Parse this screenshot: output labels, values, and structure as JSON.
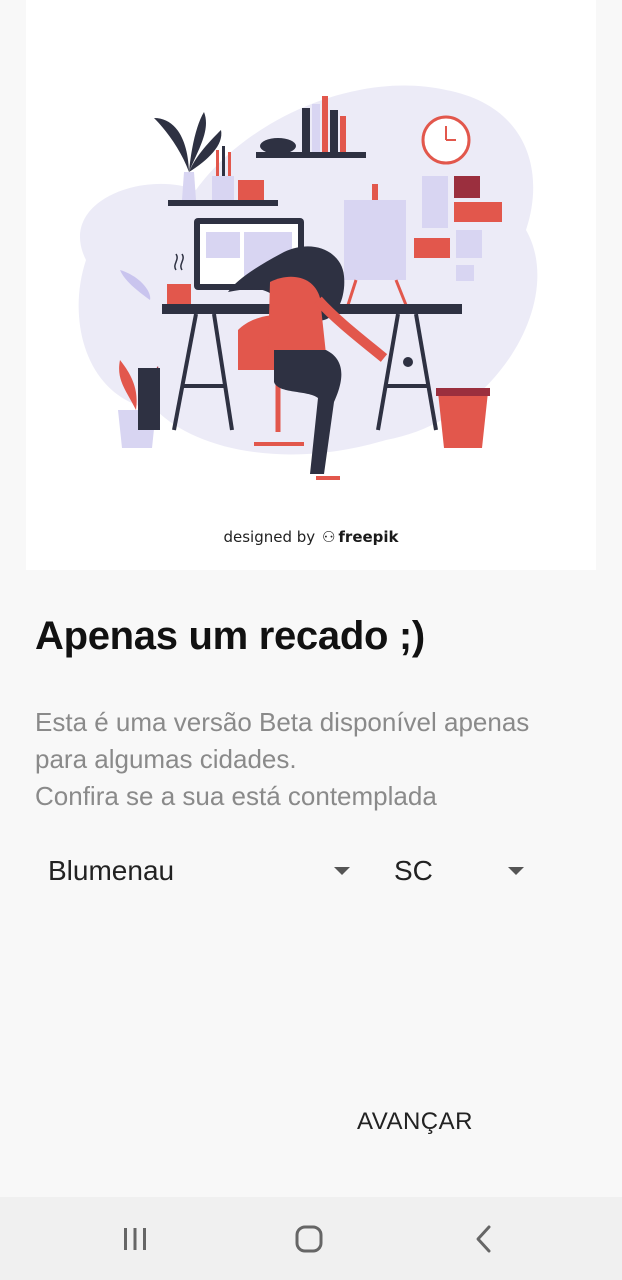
{
  "illustration": {
    "credit_prefix": "designed by",
    "credit_brand": "freepik"
  },
  "notice": {
    "title": "Apenas um recado ;)",
    "lines": [
      "Esta é uma versão Beta disponível apenas",
      "para algumas cidades.",
      "Confira se a sua está contemplada"
    ]
  },
  "city_select": {
    "value": "Blumenau"
  },
  "state_select": {
    "value": "SC"
  },
  "actions": {
    "next_label": "AVANÇAR"
  },
  "navbar": {
    "icons": [
      "recents-icon",
      "home-icon",
      "back-icon"
    ]
  },
  "colors": {
    "background": "#f8f8f8",
    "card": "#ffffff",
    "accent_red": "#e2574c",
    "lavender": "#d8d5f2",
    "dark_navy": "#2e3142"
  }
}
